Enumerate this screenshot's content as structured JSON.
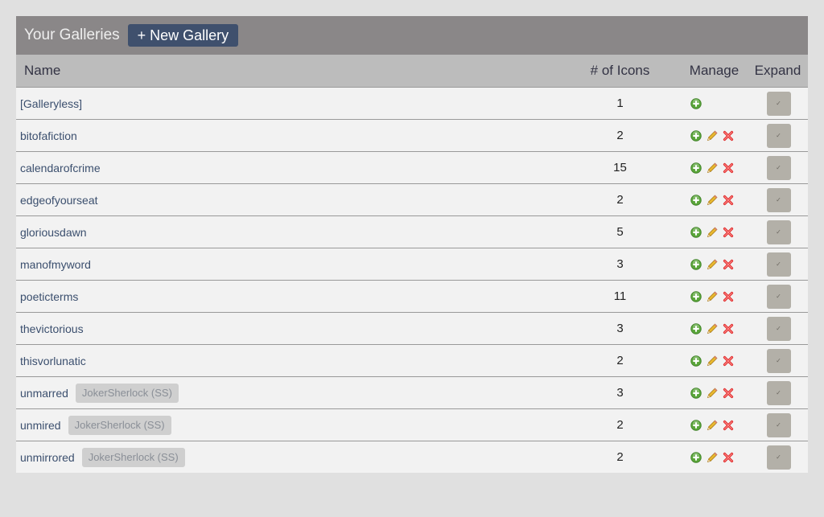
{
  "header": {
    "title": "Your Galleries",
    "new_gallery_label": "+ New Gallery"
  },
  "columns": {
    "name": "Name",
    "count": "# of Icons",
    "manage": "Manage",
    "expand": "Expand"
  },
  "colors": {
    "titlebar": "#8a8788",
    "button": "#3f506d",
    "link": "#3b4f6e",
    "add_icon": "#5aa53a",
    "edit_icon": "#e8b830",
    "delete_icon": "#e03030"
  },
  "icons": {
    "add": "plus-circle-icon",
    "edit": "pencil-icon",
    "delete": "x-icon",
    "expand": "checkmark-icon"
  },
  "rows": [
    {
      "name": "[Galleryless]",
      "tag": "",
      "count": "1",
      "actions": [
        "add"
      ]
    },
    {
      "name": "bitofafiction",
      "tag": "",
      "count": "2",
      "actions": [
        "add",
        "edit",
        "delete"
      ]
    },
    {
      "name": "calendarofcrime",
      "tag": "",
      "count": "15",
      "actions": [
        "add",
        "edit",
        "delete"
      ]
    },
    {
      "name": "edgeofyourseat",
      "tag": "",
      "count": "2",
      "actions": [
        "add",
        "edit",
        "delete"
      ]
    },
    {
      "name": "gloriousdawn",
      "tag": "",
      "count": "5",
      "actions": [
        "add",
        "edit",
        "delete"
      ]
    },
    {
      "name": "manofmyword",
      "tag": "",
      "count": "3",
      "actions": [
        "add",
        "edit",
        "delete"
      ]
    },
    {
      "name": "poeticterms",
      "tag": "",
      "count": "11",
      "actions": [
        "add",
        "edit",
        "delete"
      ]
    },
    {
      "name": "thevictorious",
      "tag": "",
      "count": "3",
      "actions": [
        "add",
        "edit",
        "delete"
      ]
    },
    {
      "name": "thisvorlunatic",
      "tag": "",
      "count": "2",
      "actions": [
        "add",
        "edit",
        "delete"
      ]
    },
    {
      "name": "unmarred",
      "tag": "JokerSherlock (SS)",
      "count": "3",
      "actions": [
        "add",
        "edit",
        "delete"
      ]
    },
    {
      "name": "unmired",
      "tag": "JokerSherlock (SS)",
      "count": "2",
      "actions": [
        "add",
        "edit",
        "delete"
      ]
    },
    {
      "name": "unmirrored",
      "tag": "JokerSherlock (SS)",
      "count": "2",
      "actions": [
        "add",
        "edit",
        "delete"
      ]
    }
  ]
}
